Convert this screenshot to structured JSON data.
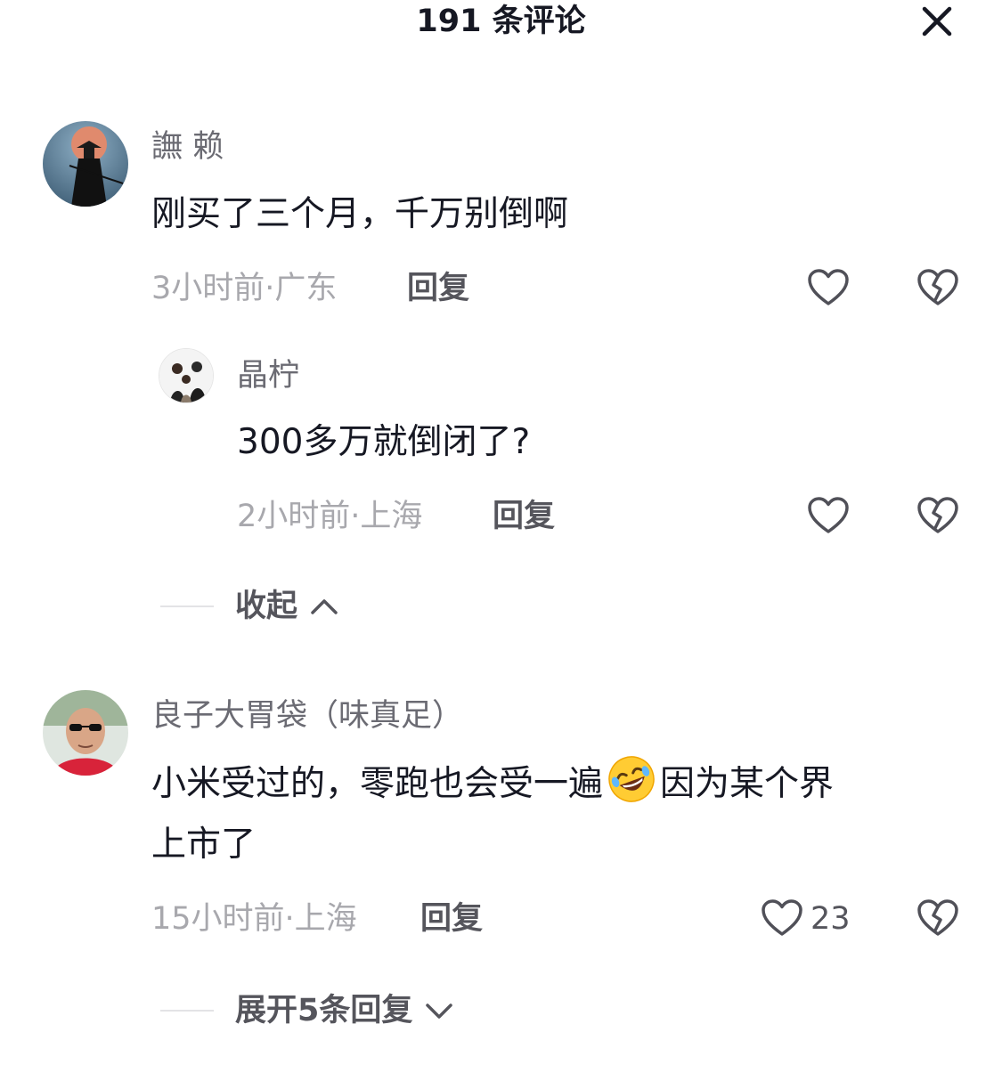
{
  "header": {
    "title": "191 条评论"
  },
  "comments": [
    {
      "username": "譕 赖",
      "text": "刚买了三个月，千万别倒啊",
      "meta": "3小时前·广东",
      "reply_label": "回复",
      "replies": [
        {
          "username": "晶柠",
          "text": "300多万就倒闭了?",
          "meta": "2小时前·上海",
          "reply_label": "回复"
        }
      ],
      "thread_toggle": "收起"
    },
    {
      "username": "良子大胃袋（味真足）",
      "text_part1": "小米受过的，零跑也会受一遍",
      "emoji": "rolling-on-floor-laughing-emoji",
      "text_part2": "因为某个界",
      "text_line2": "上市了",
      "meta": "15小时前·上海",
      "reply_label": "回复",
      "like_count": "23",
      "thread_toggle": "展开5条回复"
    }
  ],
  "icons": {
    "close": "close-icon",
    "like": "heart-outline-icon",
    "dislike": "broken-heart-icon",
    "collapse": "chevron-up-icon",
    "expand": "chevron-down-icon"
  },
  "colors": {
    "icon": "#505058",
    "meta": "#a8a8ad",
    "divider": "#e3e3e6"
  }
}
